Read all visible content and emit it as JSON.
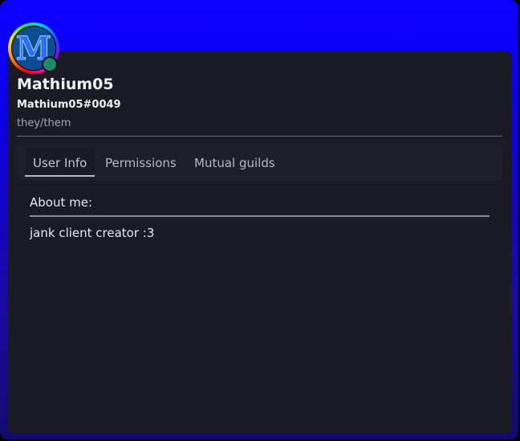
{
  "profile": {
    "avatar_letter": "M",
    "display_name": "Mathium05",
    "username_tag": "Mathium05#0049",
    "pronouns": "they/them",
    "status_color": "#1a8a6a",
    "banner_color": "#0c00ff"
  },
  "tabs": [
    {
      "label": "User Info",
      "active": true
    },
    {
      "label": "Permissions",
      "active": false
    },
    {
      "label": "Mutual guilds",
      "active": false
    }
  ],
  "about": {
    "label": "About me:",
    "bio": "jank client creator :3"
  }
}
